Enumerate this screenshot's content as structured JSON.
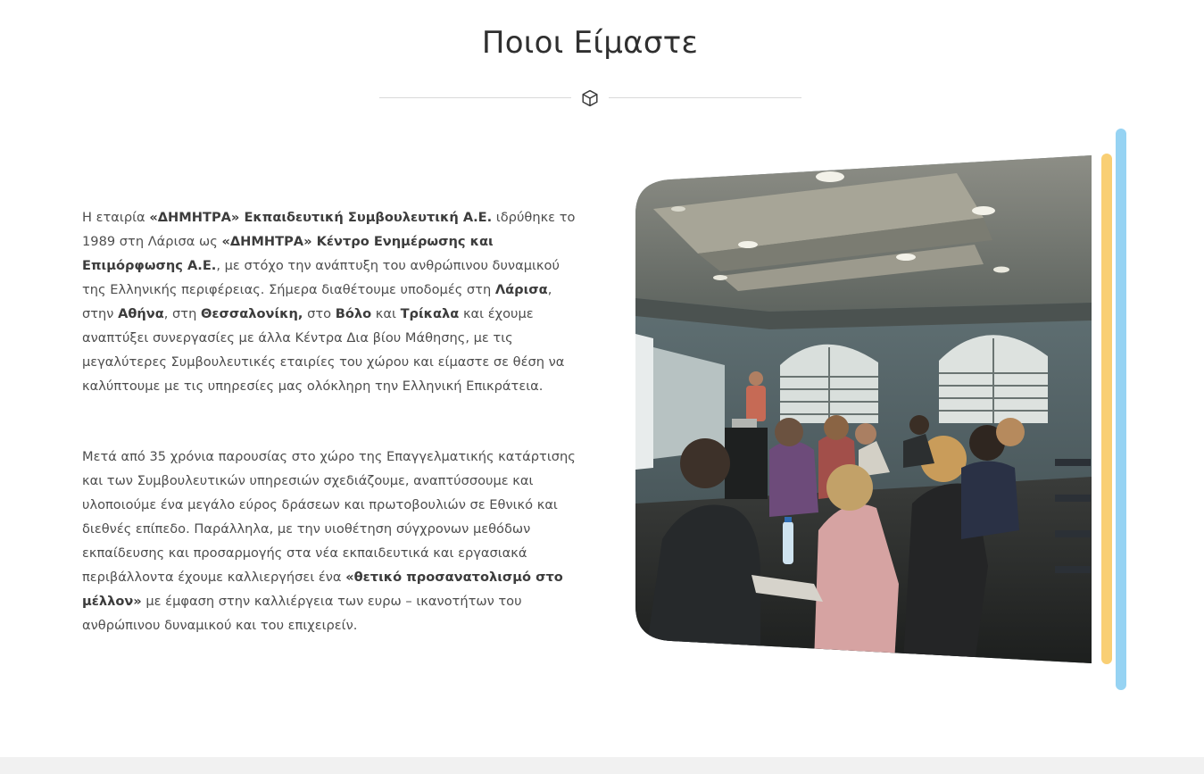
{
  "section": {
    "title": "Ποιοι Είμαστε"
  },
  "icons": {
    "divider": "cube-icon"
  },
  "paragraph1": {
    "t1": "Η εταιρία ",
    "b1": "«ΔΗΜΗΤΡΑ» Εκπαιδευτική Συμβουλευτική Α.Ε.",
    "t2": " ιδρύθηκε το 1989 στη Λάρισα ως ",
    "b2": "«ΔΗΜΗΤΡΑ» Κέντρο Ενημέρωσης και Επιμόρφωσης Α.Ε.",
    "t3": ", με στόχο την ανάπτυξη του ανθρώπινου δυναμικού της Ελληνικής περιφέρειας. Σήμερα διαθέτουμε υποδομές στη ",
    "b3": "Λάρισα",
    "t4": ", στην ",
    "b4": "Αθήνα",
    "t5": ", στη ",
    "b5": "Θεσσαλονίκη,",
    "t6": " στο ",
    "b6": "Βόλο",
    "t7": " και ",
    "b7": "Τρίκαλα",
    "t8": " και έχουμε αναπτύξει συνεργασίες με άλλα Κέντρα Δια βίου Μάθησης, με τις μεγαλύτερες Συμβουλευτικές εταιρίες του χώρου και είμαστε σε θέση να καλύπτουμε με τις υπηρεσίες μας ολόκληρη την Ελληνική Επικράτεια."
  },
  "paragraph2": {
    "t1": "Μετά από 35 χρόνια παρουσίας στο χώρο της Επαγγελματικής κατάρτισης και των Συμβουλευτικών υπηρεσιών σχεδιάζουμε, αναπτύσσουμε και υλοποιούμε ένα μεγάλο εύρος δράσεων και πρωτοβουλιών σε Εθνικό και διεθνές επίπεδο. Παράλληλα, με την υιοθέτηση σύγχρονων μεθόδων εκπαίδευσης και προσαρμογής στα νέα εκπαιδευτικά και εργασιακά περιβάλλοντα έχουμε καλλιεργήσει ένα ",
    "b1": "«θετικό προσανατολισμό στο μέλλον»",
    "t2": " με έμφαση στην καλλιέργεια των ευρω – ικανοτήτων του ανθρώπινου δυναμικού και του επιχειρείν."
  },
  "colors": {
    "accent_yellow": "#f9cf74",
    "accent_blue": "#96d3f3",
    "title": "#2f2f2f",
    "body_text": "#4d4d4d"
  }
}
